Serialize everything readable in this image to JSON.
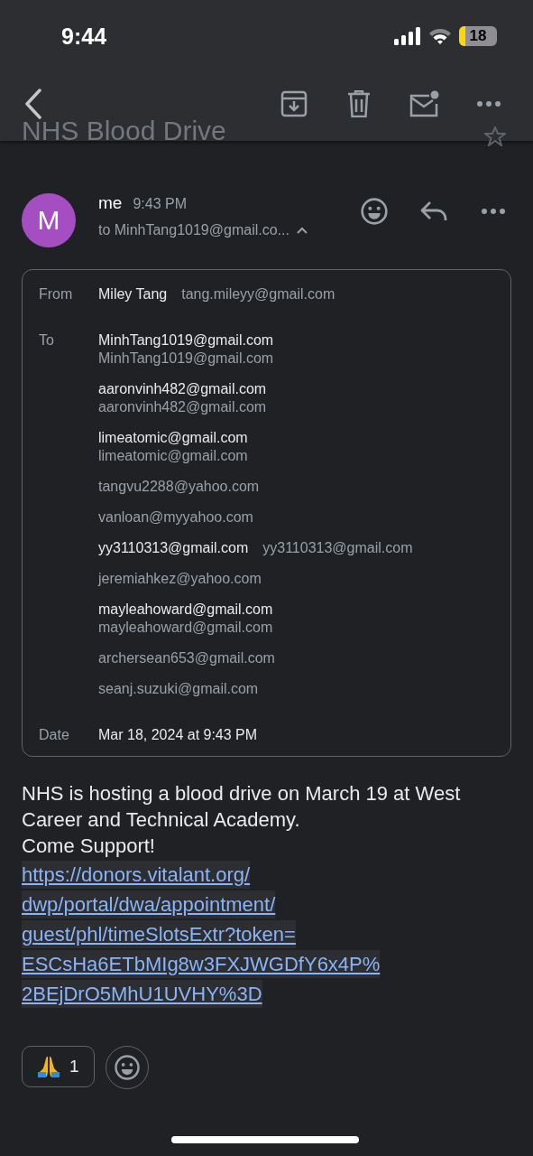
{
  "status_bar": {
    "time": "9:44",
    "battery": "18"
  },
  "subject": "NHS Blood Drive",
  "message": {
    "avatar": "M",
    "sender": "me",
    "time": "9:43 PM",
    "to_summary": "to MinhTang1019@gmail.co...",
    "expanded": true
  },
  "details": {
    "from_label": "From",
    "from_name": "Miley Tang",
    "from_email": "tang.mileyy@gmail.com",
    "to_label": "To",
    "recipients": [
      {
        "kind": "stacked",
        "name": "MinhTang1019@gmail.com",
        "email": "MinhTang1019@gmail.com"
      },
      {
        "kind": "stacked",
        "name": "aaronvinh482@gmail.com",
        "email": "aaronvinh482@gmail.com"
      },
      {
        "kind": "stacked",
        "name": "limeatomic@gmail.com",
        "email": "limeatomic@gmail.com"
      },
      {
        "kind": "email_only",
        "email": "tangvu2288@yahoo.com"
      },
      {
        "kind": "email_only",
        "email": "vanloan@myyahoo.com"
      },
      {
        "kind": "inline",
        "name": "yy3110313@gmail.com",
        "email": "yy3110313@gmail.com"
      },
      {
        "kind": "email_only",
        "email": "jeremiahkez@yahoo.com"
      },
      {
        "kind": "stacked",
        "name": "mayleahoward@gmail.com",
        "email": "mayleahoward@gmail.com"
      },
      {
        "kind": "email_only",
        "email": "archersean653@gmail.com"
      },
      {
        "kind": "email_only",
        "email": "seanj.suzuki@gmail.com"
      }
    ],
    "date_label": "Date",
    "date": "Mar 18, 2024 at 9:43 PM"
  },
  "body": {
    "text": "NHS is hosting a blood drive on March 19 at West Career and Technical Academy.\nCome Support!",
    "link_lines": [
      "https://donors.vitalant.org/",
      "dwp/portal/dwa/appointment/",
      "guest/phl/timeSlotsExtr?token=",
      "ESCsHa6ETbMIg8w3FXJWGDfY6x4P%",
      "2BEjDrO5MhU1UVHY%3D"
    ]
  },
  "reactions": [
    {
      "count": "1"
    }
  ]
}
